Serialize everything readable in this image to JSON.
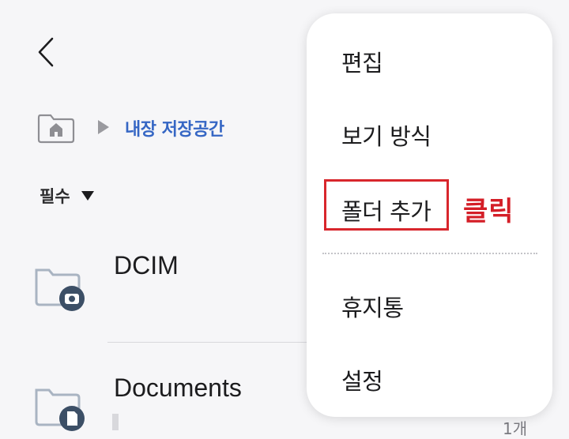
{
  "breadcrumb": {
    "current": "내장 저장공간"
  },
  "filter": {
    "label": "필수"
  },
  "folders": [
    {
      "name": "DCIM"
    },
    {
      "name": "Documents",
      "count": "1개"
    }
  ],
  "menu": {
    "items": [
      "편집",
      "보기 방식",
      "폴더 추가",
      "휴지통",
      "설정"
    ]
  },
  "annotation": {
    "label": "클릭",
    "color": "#d41e27"
  },
  "colors": {
    "accent": "#3566c4",
    "folder_icon": "#3c4f66",
    "highlight": "#d8262c"
  },
  "icons": [
    "back-chevron-icon",
    "home-icon",
    "breadcrumb-arrow-icon",
    "caret-down-icon",
    "camera-folder-icon",
    "document-folder-icon"
  ]
}
